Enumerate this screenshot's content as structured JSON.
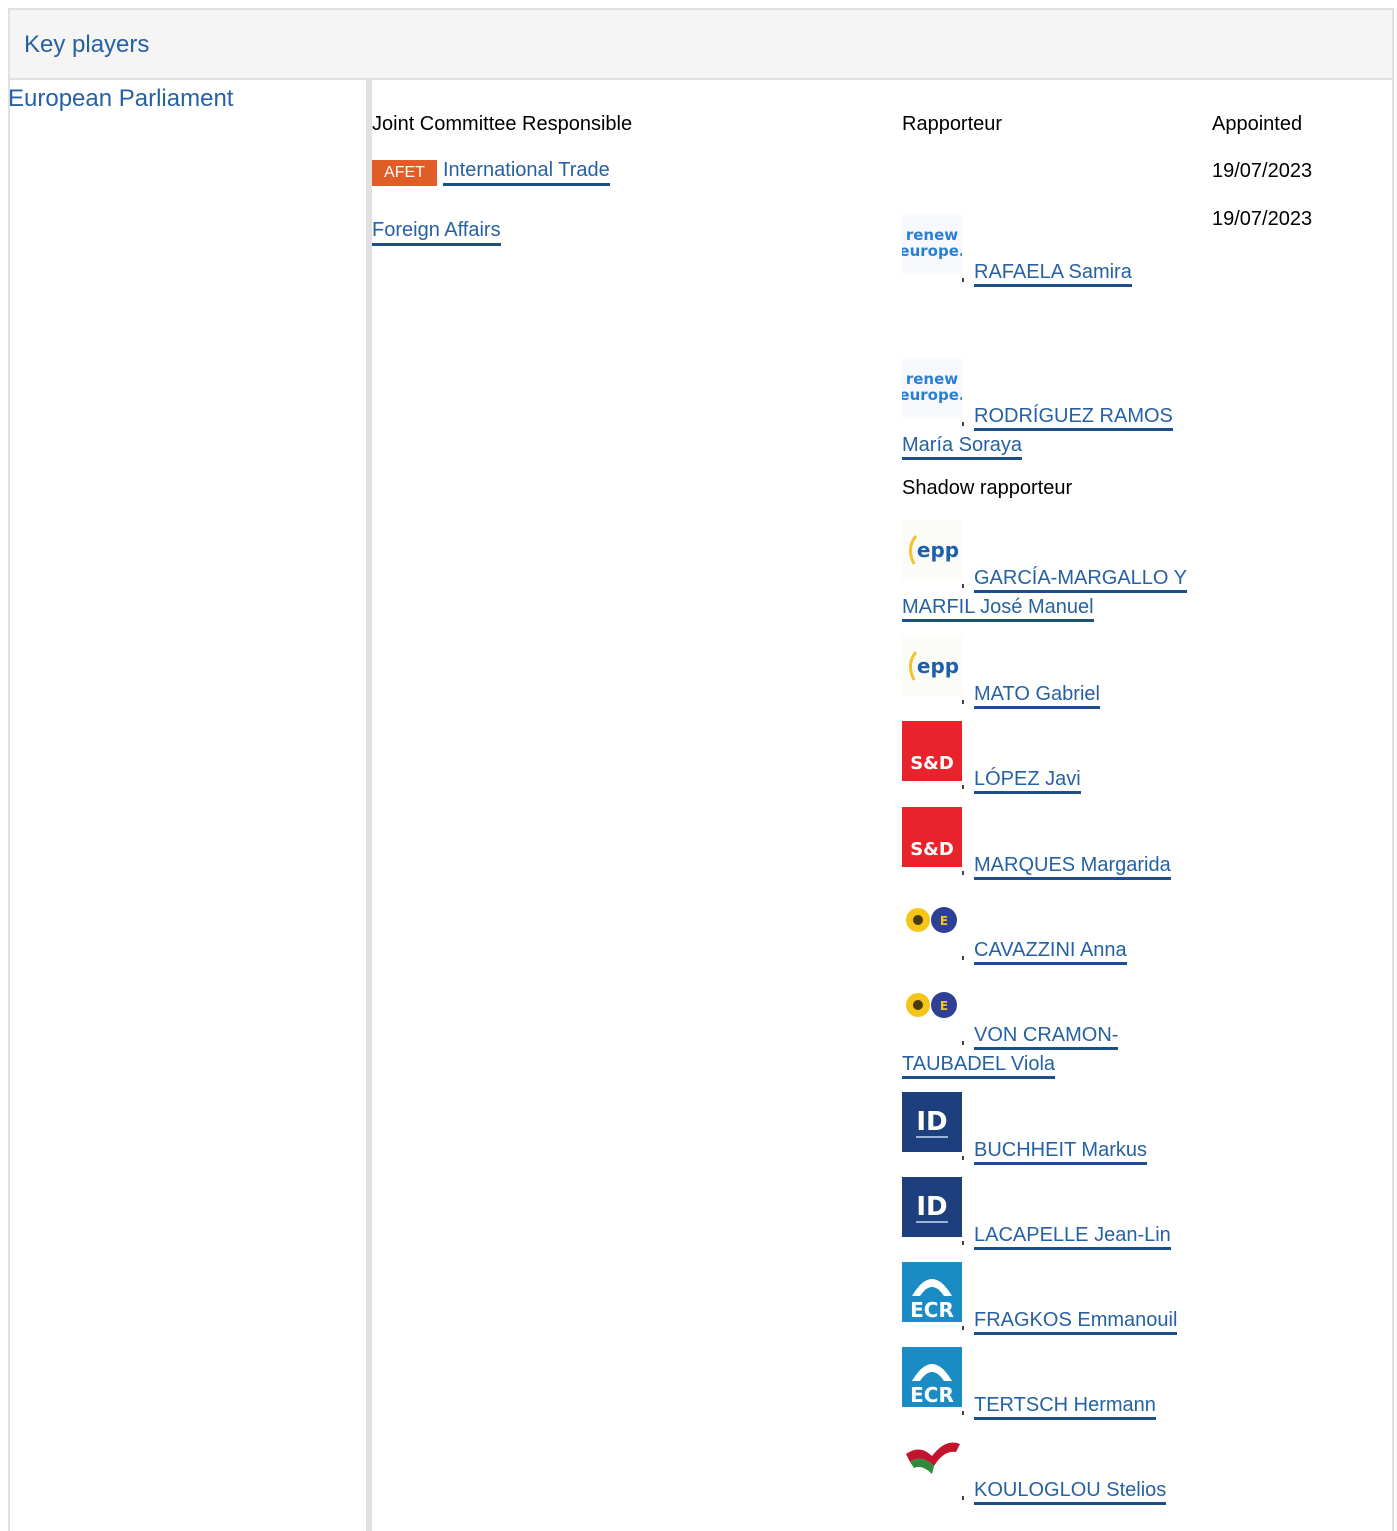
{
  "section": {
    "title": "Key players"
  },
  "institution": "European Parliament",
  "columns": {
    "committee": "Joint Committee Responsible",
    "rapporteur": "Rapporteur",
    "appointed": "Appointed"
  },
  "committees": [
    {
      "badge": "AFET",
      "name": "International Trade",
      "date": "19/07/2023"
    },
    {
      "badge": "",
      "name": "Foreign Affairs",
      "date": "19/07/2023"
    }
  ],
  "rapporteurs": [
    {
      "group": "renew-europe-logo",
      "name": "RAFAELA Samira"
    },
    {
      "group": "renew-europe-logo",
      "name": "RODRÍGUEZ RAMOS María Soraya"
    }
  ],
  "shadow_label": "Shadow rapporteur",
  "shadow_rapporteurs": [
    {
      "group": "epp-logo",
      "name": "GARCÍA-MARGALLO Y MARFIL José Manuel"
    },
    {
      "group": "epp-logo",
      "name": "MATO Gabriel"
    },
    {
      "group": "sd-logo",
      "name": "LÓPEZ Javi"
    },
    {
      "group": "sd-logo",
      "name": "MARQUES Margarida"
    },
    {
      "group": "greens-efa-logo",
      "name": "CAVAZZINI Anna"
    },
    {
      "group": "greens-efa-logo",
      "name": "VON CRAMON-TAUBADEL Viola"
    },
    {
      "group": "id-logo",
      "name": "BUCHHEIT Markus"
    },
    {
      "group": "id-logo",
      "name": "LACAPELLE Jean-Lin"
    },
    {
      "group": "ecr-logo",
      "name": "FRAGKOS Emmanouil"
    },
    {
      "group": "ecr-logo",
      "name": "TERTSCH Hermann"
    },
    {
      "group": "the-left-logo",
      "name": "KOULOGLOU Stelios"
    }
  ],
  "logo_text": {
    "renew": [
      "renew",
      "europe."
    ],
    "epp": "epp",
    "sd": "S&D",
    "id": "ID",
    "ecr": "ECR"
  },
  "colors": {
    "link": "#2661a4",
    "badge": "#e15c26",
    "header_bg": "#f5f5f5"
  }
}
